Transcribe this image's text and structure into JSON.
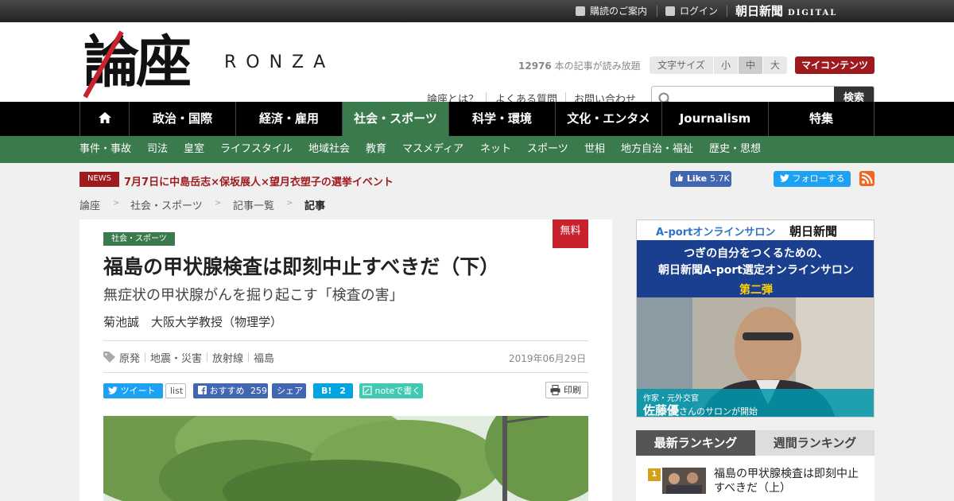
{
  "topbar": {
    "guide": "購読のご案内",
    "login": "ログイン",
    "brand": "朝日新聞",
    "brand_digital": "DIGITAL"
  },
  "header": {
    "logo_kanji": "論座",
    "logo_text": "RONZA",
    "count_number": "12976",
    "count_text": "本の記事が読み放題",
    "font_size_label": "文字サイズ",
    "font_sizes": [
      "小",
      "中",
      "大"
    ],
    "my_content": "マイコンテンツ",
    "links": [
      "論座とは？",
      "よくある質問",
      "お問い合わせ"
    ],
    "search_button": "検索"
  },
  "nav": {
    "home_icon": "home-icon",
    "tabs": [
      "政治・国際",
      "経済・雇用",
      "社会・スポーツ",
      "科学・環境",
      "文化・エンタメ",
      "Journalism",
      "特集"
    ],
    "active_tab": "社会・スポーツ"
  },
  "subnav": [
    "事件・事故",
    "司法",
    "皇室",
    "ライフスタイル",
    "地域社会",
    "教育",
    "マスメディア",
    "ネット",
    "スポーツ",
    "世相",
    "地方自治・福祉",
    "歴史・思想"
  ],
  "news": {
    "badge": "NEWS",
    "text": "7月7日に中島岳志×保坂展人×望月衣塑子の選挙イベント"
  },
  "social": {
    "fb_label": "Like",
    "fb_count": "5.7K",
    "twitter_follow": "フォローする"
  },
  "breadcrumb": [
    "論座",
    "社会・スポーツ",
    "記事一覧",
    "記事"
  ],
  "article": {
    "category": "社会・スポーツ",
    "free_badge": "無料",
    "title": "福島の甲状腺検査は即刻中止すべきだ（下）",
    "subtitle": "無症状の甲状腺がんを掘り起こす「検査の害」",
    "author": "菊池誠　大阪大学教授（物理学）",
    "tags": [
      "原発",
      "地震・災害",
      "放射線",
      "福島"
    ],
    "date": "2019年06月29日",
    "share": {
      "tweet": "ツイート",
      "list": "list",
      "recommend": "おすすめ",
      "recommend_count": "259",
      "fb_share": "シェア",
      "hatena_label": "B!",
      "hatena_count": "2",
      "note": "noteで書く",
      "print": "印刷"
    }
  },
  "ad": {
    "aport": "A-portオンラインサロン",
    "asahi": "朝日新聞",
    "line1": "つぎの自分をつくるための、",
    "line2": "朝日新聞A-port選定オンラインサロン",
    "line3": "第二弾",
    "role": "作家・元外交官",
    "name": "佐藤優",
    "name_suffix": "さんのサロンが開始"
  },
  "ranking": {
    "tabs": [
      "最新ランキング",
      "週間ランキング"
    ],
    "items": [
      {
        "rank": "1",
        "title": "福島の甲状腺検査は即刻中止すべきだ（上）"
      }
    ]
  },
  "colors": {
    "accent_green": "#3a7a4c",
    "accent_red": "#9e1a1f",
    "nav_black": "#000000"
  }
}
